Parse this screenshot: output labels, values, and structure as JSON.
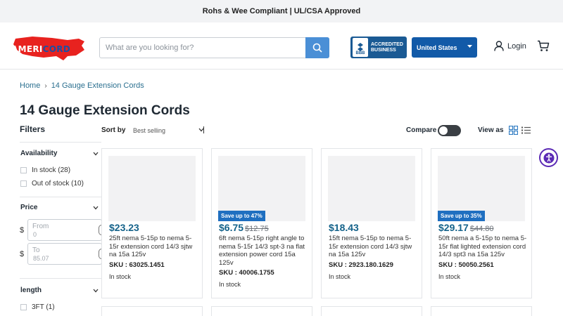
{
  "announcement": "Rohs & Wee Compliant | UL/CSA Approved",
  "header": {
    "logo": {
      "part1": "AMERI",
      "part2": "CORD"
    },
    "search_placeholder": "What are you looking for?",
    "bbb": {
      "seal": "BBB",
      "line1": "ACCREDITED",
      "line2": "BUSINESS"
    },
    "country": "United States",
    "login": "Login"
  },
  "breadcrumb": {
    "home": "Home",
    "sep": "›",
    "current": "14 Gauge Extension Cords"
  },
  "page_title": "14 Gauge Extension Cords",
  "filters": {
    "title": "Filters",
    "availability": {
      "title": "Availability",
      "options": [
        "In stock (28)",
        "Out of stock (10)"
      ]
    },
    "price": {
      "title": "Price",
      "currency": "$",
      "from_label": "From",
      "from_value": "0",
      "to_label": "To",
      "to_value": "85.07"
    },
    "length": {
      "title": "length",
      "options": [
        "3FT (1)"
      ]
    }
  },
  "toolbar": {
    "sort_label": "Sort by",
    "sort_value": "Best selling",
    "compare": "Compare",
    "view_as": "View as"
  },
  "products": [
    {
      "badge": "",
      "price": "$23.23",
      "was": "",
      "title": "25ft nema 5-15p to nema 5-15r extension cord 14/3 sjtw na 15a 125v",
      "sku": "SKU : 63025.1451",
      "stock": "In stock"
    },
    {
      "badge": "Save up to 47%",
      "price": "$6.75",
      "was": "$12.75",
      "title": "6ft nema 5-15p right angle to nema 5-15r 14/3 spt-3 na flat extension power cord 15a 125v",
      "sku": "SKU : 40006.1755",
      "stock": "In stock"
    },
    {
      "badge": "",
      "price": "$18.43",
      "was": "",
      "title": "15ft nema 5-15p to nema 5-15r extension cord 14/3 sjtw na 15a 125v",
      "sku": "SKU : 2923.180.1629",
      "stock": "In stock"
    },
    {
      "badge": "Save up to 35%",
      "price": "$29.17",
      "was": "$44.80",
      "title": "50ft nema a 5-15p to nema 5-15r flat lighted extension cord 14/3 spt3 na 15a 125v",
      "sku": "SKU : 50050.2561",
      "stock": "In stock"
    }
  ],
  "colors": {
    "brand_blue": "#125aa8",
    "price_teal": "#14628a",
    "badge_blue": "#1f6fc0",
    "logo_red": "#e8221f"
  }
}
